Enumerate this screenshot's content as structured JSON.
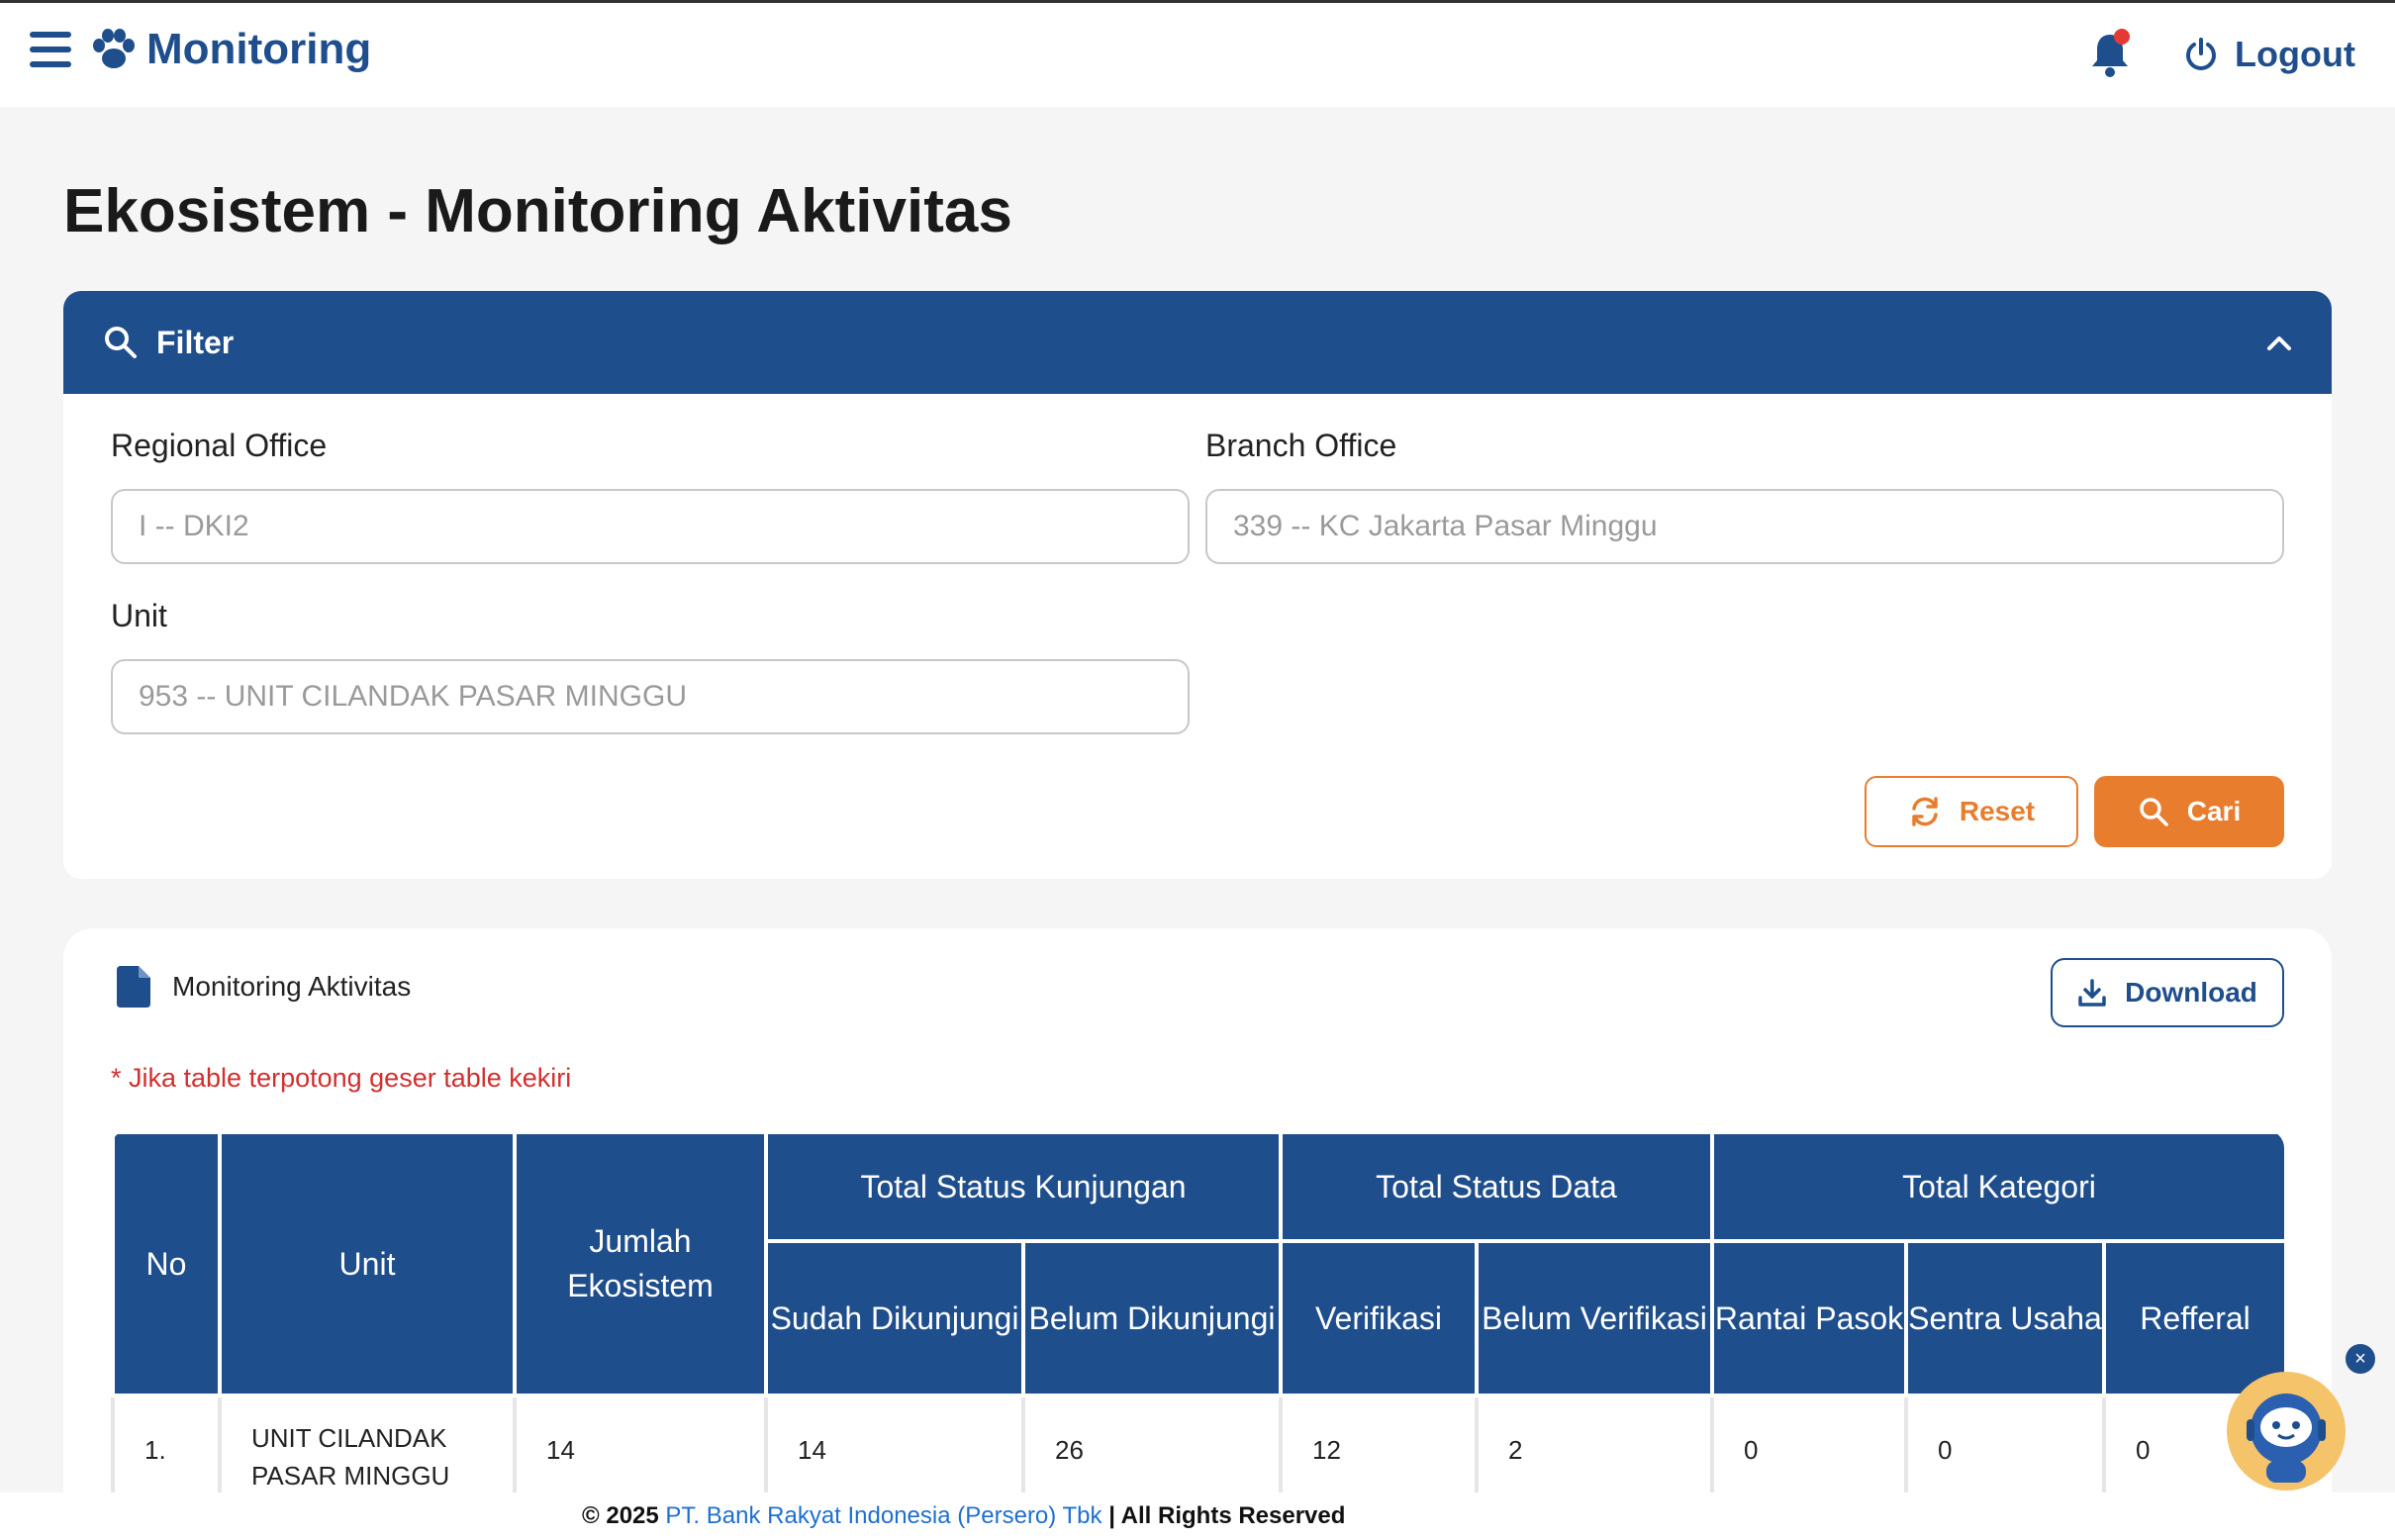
{
  "navbar": {
    "brand": "Monitoring",
    "logout_label": "Logout",
    "notification_dot": true
  },
  "page": {
    "title": "Ekosistem - Monitoring Aktivitas"
  },
  "filter": {
    "header": "Filter",
    "regional_office": {
      "label": "Regional Office",
      "placeholder": "I -- DKI2"
    },
    "branch_office": {
      "label": "Branch Office",
      "placeholder": "339 -- KC Jakarta Pasar Minggu"
    },
    "unit": {
      "label": "Unit",
      "placeholder": "953 -- UNIT CILANDAK PASAR MINGGU"
    },
    "reset_label": "Reset",
    "search_label": "Cari"
  },
  "table_card": {
    "title": "Monitoring Aktivitas",
    "download_label": "Download",
    "note": "* Jika table terpotong geser table kekiri",
    "headers": {
      "no": "No",
      "unit": "Unit",
      "jumlah": "Jumlah Ekosistem",
      "group_kunjungan": "Total Status Kunjungan",
      "group_data": "Total Status Data",
      "group_kategori": "Total Kategori",
      "sudah": "Sudah Dikunjungi",
      "belum": "Belum Dikunjungi",
      "verifikasi": "Verifikasi",
      "belum_verifikasi": "Belum Verifikasi",
      "rantai": "Rantai Pasok",
      "sentra": "Sentra Usaha",
      "refferal": "Refferal"
    },
    "rows": [
      {
        "no": "1.",
        "unit": "UNIT CILANDAK PASAR MINGGU",
        "jumlah": "14",
        "sudah": "14",
        "belum": "26",
        "verifikasi": "12",
        "belum_verifikasi": "2",
        "rantai": "0",
        "sentra": "0",
        "refferal": "0"
      }
    ]
  },
  "footer": {
    "prefix": "© 2025",
    "company": "PT. Bank Rakyat Indonesia (Persero) Tbk",
    "suffix": "| All Rights Reserved"
  },
  "colors": {
    "primary": "#1f4e8c",
    "accent": "#e87d2e",
    "note": "#d32f2f",
    "link": "#1f6fd1"
  }
}
